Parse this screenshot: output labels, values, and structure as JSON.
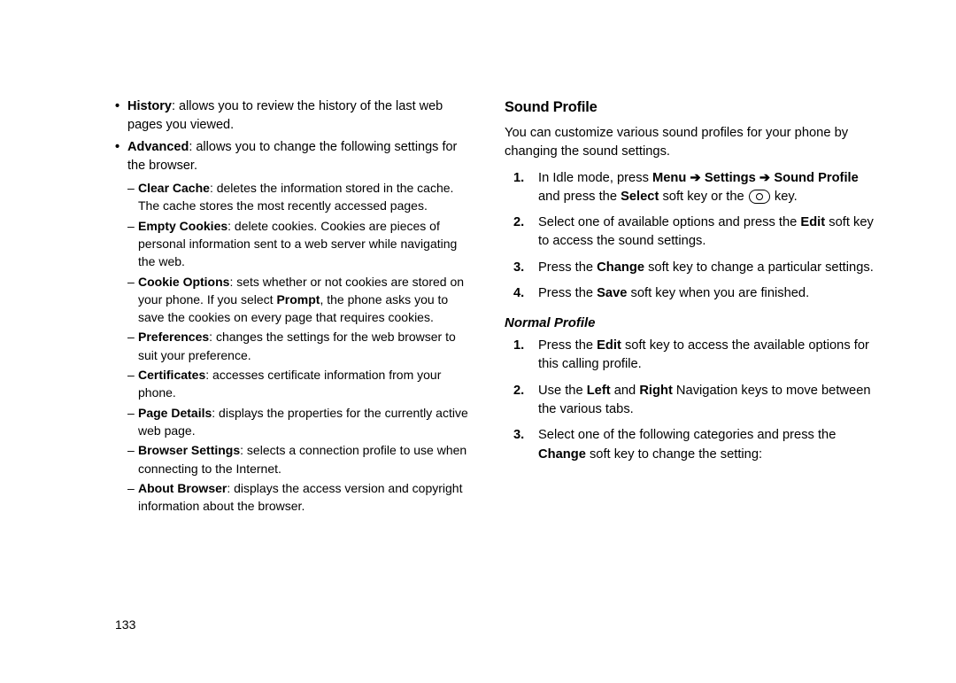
{
  "left": {
    "bullets": [
      {
        "term": "History",
        "rest": ": allows you to review the history of the last web pages you viewed."
      },
      {
        "term": "Advanced",
        "rest": ": allows you to change the following settings for the browser.",
        "dashes": [
          {
            "term": "Clear Cache",
            "rest": ": deletes the information stored in the cache. The cache stores the most recently accessed pages."
          },
          {
            "term": "Empty Cookies",
            "rest": ": delete cookies. Cookies are pieces of personal information sent to a web server while navigating the web."
          },
          {
            "term": "Cookie Options",
            "rest_before": ": sets whether or not cookies are stored on your phone. If you select ",
            "bold2": "Prompt",
            "rest_after": ", the phone asks you to save the cookies on every page that requires cookies."
          },
          {
            "term": "Preferences",
            "rest": ": changes the settings for the web browser to suit your preference."
          },
          {
            "term": "Certificates",
            "rest": ": accesses certificate information from your phone."
          },
          {
            "term": "Page Details",
            "rest": ": displays the properties for the currently active web page."
          },
          {
            "term": "Browser Settings",
            "rest": ": selects a connection profile to use when connecting to the Internet."
          },
          {
            "term": "About Browser",
            "rest": ": displays the access version and copyright information about the browser."
          }
        ]
      }
    ]
  },
  "right": {
    "title": "Sound Profile",
    "intro": "You can customize various sound profiles for your phone by changing the sound settings.",
    "steps": [
      {
        "num": "1.",
        "segments": [
          {
            "t": "In Idle mode, press "
          },
          {
            "t": "Menu",
            "b": true
          },
          {
            "t": " "
          },
          {
            "arrow": true
          },
          {
            "t": " "
          },
          {
            "t": "Settings",
            "b": true
          },
          {
            "t": " "
          },
          {
            "arrow": true
          },
          {
            "t": " "
          },
          {
            "t": "Sound Profile",
            "b": true
          },
          {
            "t": " and press the "
          },
          {
            "t": "Select",
            "b": true
          },
          {
            "t": " soft key or the "
          },
          {
            "keyicon": true
          },
          {
            "t": " key."
          }
        ]
      },
      {
        "num": "2.",
        "segments": [
          {
            "t": "Select one of available options and press the "
          },
          {
            "t": "Edit",
            "b": true
          },
          {
            "t": " soft key to access the sound settings."
          }
        ]
      },
      {
        "num": "3.",
        "segments": [
          {
            "t": "Press the "
          },
          {
            "t": "Change",
            "b": true
          },
          {
            "t": " soft key to change a particular settings."
          }
        ]
      },
      {
        "num": "4.",
        "segments": [
          {
            "t": "Press the "
          },
          {
            "t": "Save",
            "b": true
          },
          {
            "t": " soft key when you are finished."
          }
        ]
      }
    ],
    "subsect": "Normal Profile",
    "steps2": [
      {
        "num": "1.",
        "segments": [
          {
            "t": "Press the "
          },
          {
            "t": "Edit",
            "b": true
          },
          {
            "t": " soft key to access the available options for this calling profile."
          }
        ]
      },
      {
        "num": "2.",
        "segments": [
          {
            "t": "Use the "
          },
          {
            "t": "Left",
            "b": true
          },
          {
            "t": " and "
          },
          {
            "t": "Right",
            "b": true
          },
          {
            "t": " Navigation keys to move between the various tabs."
          }
        ]
      },
      {
        "num": "3.",
        "segments": [
          {
            "t": "Select one of the following categories and press the "
          },
          {
            "t": "Change",
            "b": true
          },
          {
            "t": " soft key to change the setting:"
          }
        ]
      }
    ]
  },
  "pageNumber": "133"
}
